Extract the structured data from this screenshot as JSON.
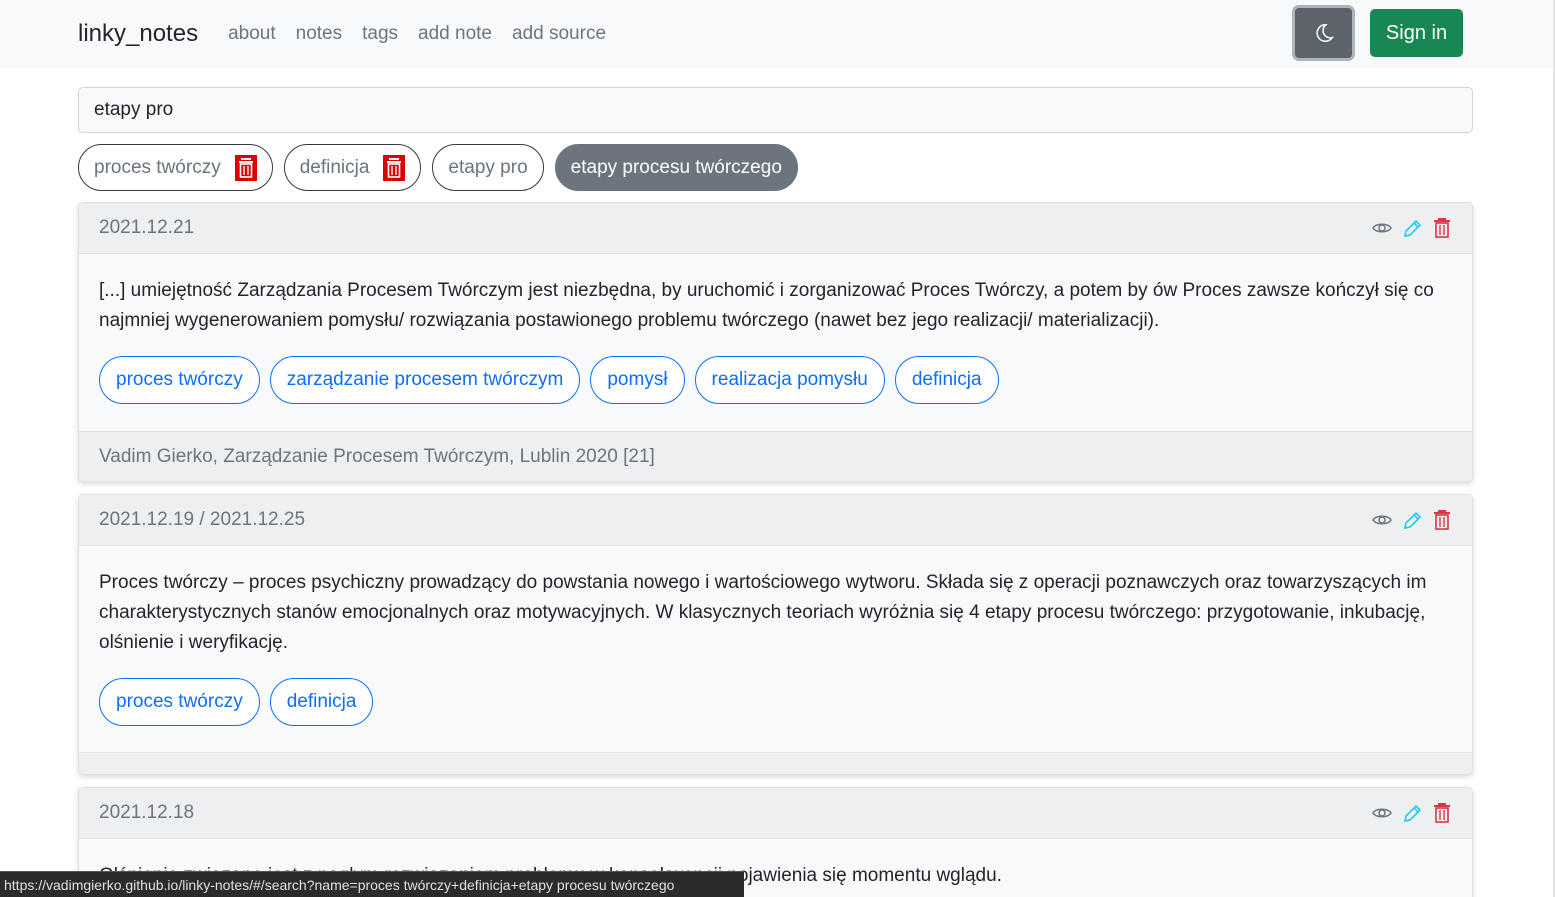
{
  "nav": {
    "brand": "linky_notes",
    "links": [
      "about",
      "notes",
      "tags",
      "add note",
      "add source"
    ],
    "signin_label": "Sign in"
  },
  "search": {
    "value": "etapy pro"
  },
  "filter_chips": [
    {
      "label": "proces twórczy",
      "removable": true
    },
    {
      "label": "definicja",
      "removable": true
    },
    {
      "label": "etapy pro",
      "removable": false
    },
    {
      "label": "etapy procesu twórczego",
      "removable": false,
      "active": true
    }
  ],
  "notes": [
    {
      "date": "2021.12.21",
      "text": "[...] umiejętność Zarządzania Procesem Twórczym jest niezbędna, by uruchomić i zorganizować Proces Twórczy, a potem by ów Proces zawsze kończył się co najmniej wygenerowaniem pomysłu/ rozwiązania postawionego problemu twórczego (nawet bez jego realizacji/ materializacji).",
      "tags": [
        "proces twórczy",
        "zarządzanie procesem twórczym",
        "pomysł",
        "realizacja pomysłu",
        "definicja"
      ],
      "source": "Vadim Gierko, Zarządzanie Procesem Twórczym, Lublin 2020 [21]"
    },
    {
      "date": "2021.12.19 / 2021.12.25",
      "text": "Proces twórczy – proces psychiczny prowadzący do powstania nowego i wartościowego wytworu. Składa się z operacji poznawczych oraz towarzyszących im charakterystycznych stanów emocjonalnych oraz motywacyjnych. W klasycznych teoriach wyróżnia się 4 etapy procesu twórczego: przygotowanie, inkubację, olśnienie i weryfikację.",
      "tags": [
        "proces twórczy",
        "definicja"
      ],
      "source": ""
    },
    {
      "date": "2021.12.18",
      "text": "Olśnienie związane jest z nagłym rozwiązaniem problemu w konsekwencji pojawienia się momentu wglądu.",
      "tags": [],
      "source": ""
    }
  ],
  "status_url": "https://vadimgierko.github.io/linky-notes/#/search?name=proces twórczy+definicja+etapy procesu twórczego",
  "colors": {
    "primary": "#0d6efd",
    "success": "#198754",
    "danger": "#dc3545",
    "info": "#0dcaf0",
    "secondary": "#6c757d"
  }
}
